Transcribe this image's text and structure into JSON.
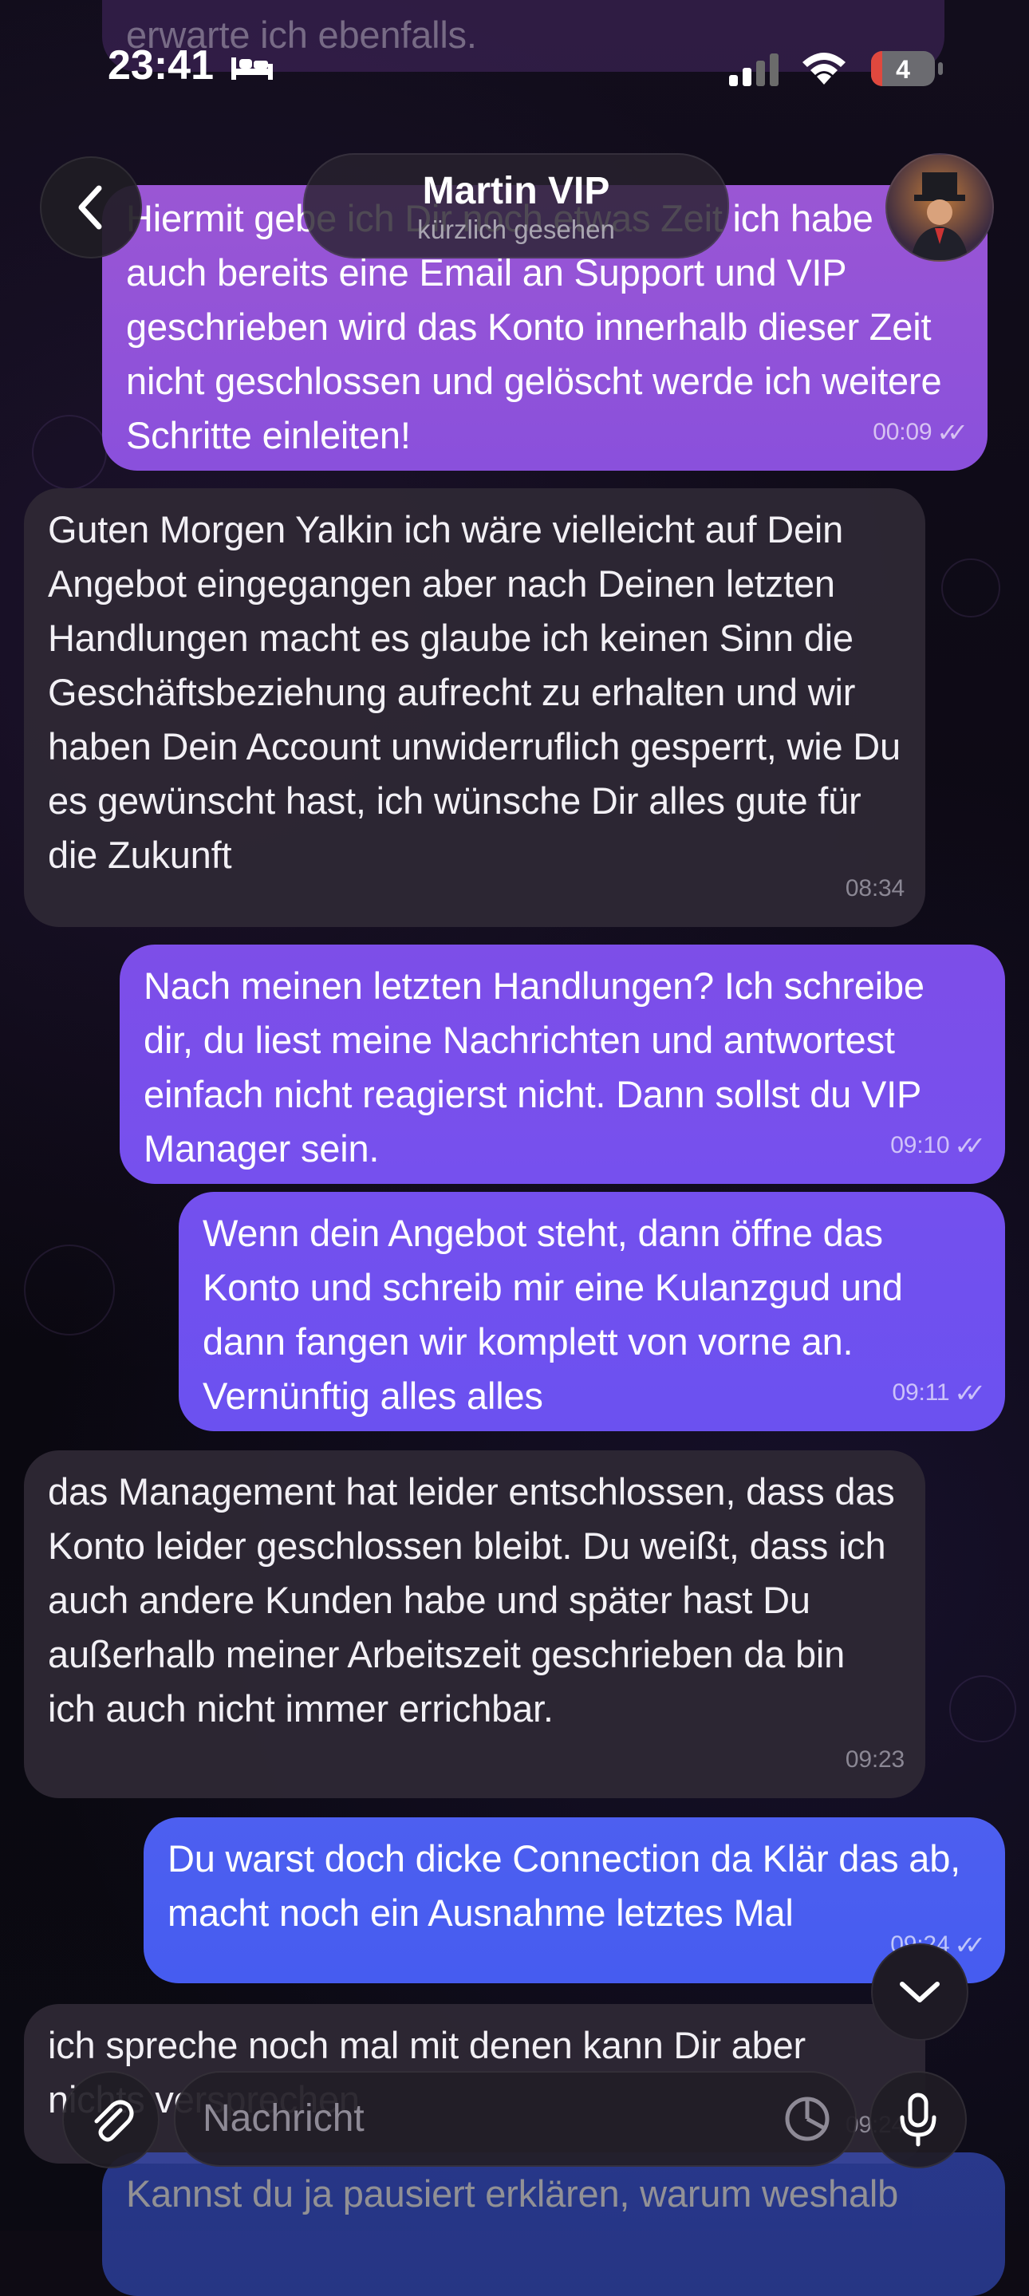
{
  "status_bar": {
    "time": "23:41",
    "battery": "4",
    "sleep_icon": "bed-icon",
    "signal_icon": "signal-icon",
    "wifi_icon": "wifi-icon"
  },
  "header": {
    "name": "Martin VIP",
    "subtitle": "kürzlich gesehen",
    "back_icon": "chevron-left-icon",
    "avatar_icon": "avatar"
  },
  "colors": {
    "incoming": "#2e2834",
    "outgoing_top": "#9250d8",
    "outgoing_mid": "#6f50ef",
    "outgoing_bottom": "#4a5ef0",
    "background": "#0e0b14"
  },
  "top_partial": {
    "text": "erwarte ich ebenfalls."
  },
  "messages": [
    {
      "direction": "outgoing",
      "text": "Hiermit gebe ich Dir noch etwas Zeit ich habe auch bereits eine Email an Support und VIP geschrieben wird das Konto innerhalb dieser Zeit nicht geschlossen und gelöscht werde ich weitere Schritte einleiten!",
      "time": "00:09"
    },
    {
      "direction": "incoming",
      "text": "Guten Morgen Yalkin ich wäre vielleicht auf Dein Angebot eingegangen aber nach Deinen letzten Handlungen macht es glaube ich keinen Sinn die Geschäftsbeziehung aufrecht zu erhalten und wir haben Dein Account unwiderruflich gesperrt, wie Du es gewünscht hast, ich wünsche Dir alles gute für die Zukunft",
      "time": "08:34"
    },
    {
      "direction": "outgoing",
      "text": "Nach meinen letzten Handlungen? Ich schreibe dir, du liest meine Nachrichten und antwortest einfach nicht reagierst nicht. Dann sollst du VIP Manager sein.",
      "time": "09:10"
    },
    {
      "direction": "outgoing",
      "text": "Wenn dein Angebot steht, dann öffne das Konto und schreib mir eine Kulanzgud und dann fangen wir komplett von vorne an. Vernünftig alles alles",
      "time": "09:11"
    },
    {
      "direction": "incoming",
      "text": "das Management hat leider entschlossen, dass das Konto leider geschlossen bleibt. Du weißt, dass ich auch andere Kunden habe und später hast Du außerhalb meiner Arbeitszeit geschrieben da bin ich auch nicht immer errichbar.",
      "time": "09:23"
    },
    {
      "direction": "outgoing",
      "text": "Du warst doch dicke Connection da Klär das ab, macht noch ein Ausnahme letztes Mal",
      "time": "09:24"
    },
    {
      "direction": "incoming",
      "text": "ich spreche noch mal mit denen kann Dir aber nichts versprechen",
      "time": "09:24"
    },
    {
      "direction": "outgoing",
      "text": "Kannst du ja pausiert erklären, warum weshalb",
      "time": ""
    }
  ],
  "composer": {
    "placeholder": "Nachricht",
    "attach_icon": "paperclip-icon",
    "sticker_icon": "sticker-icon",
    "mic_icon": "microphone-icon",
    "scroll_down_icon": "chevron-down-icon"
  }
}
